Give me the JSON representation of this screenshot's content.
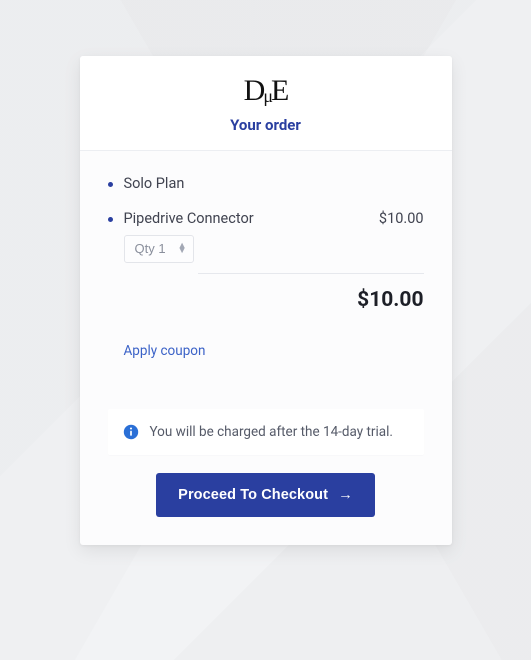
{
  "logo": {
    "text": "DμE"
  },
  "card_title": "Your order",
  "line_items": [
    {
      "name": "Solo Plan",
      "price": "",
      "has_qty": false
    },
    {
      "name": "Pipedrive Connector",
      "price": "$10.00",
      "has_qty": true,
      "qty_label": "Qty 1"
    }
  ],
  "total": "$10.00",
  "coupon_link_label": "Apply coupon",
  "notice_text": "You will be charged after the 14-day trial.",
  "checkout_button_label": "Proceed To Checkout"
}
